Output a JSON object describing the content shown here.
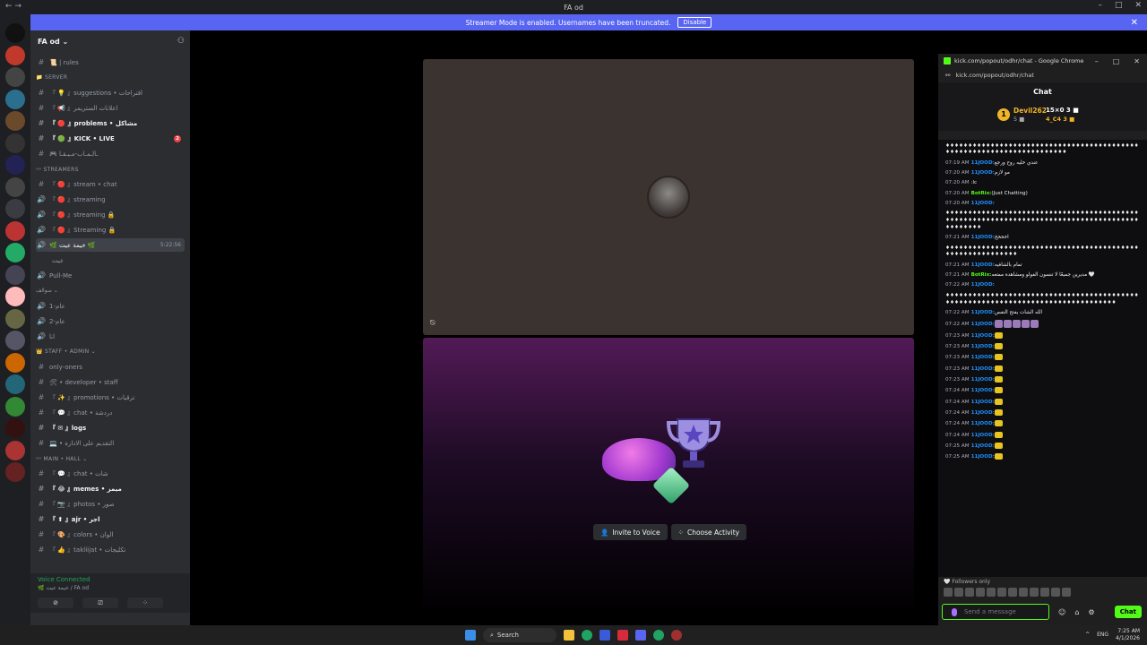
{
  "window": {
    "title": "FA od"
  },
  "banner": {
    "text": "Streamer Mode is enabled. Usernames have been truncated.",
    "button": "Disable"
  },
  "guild": {
    "name": "FA od ⌄"
  },
  "channels": [
    {
      "kind": "text",
      "label": "📜 | rules",
      "bold": false
    },
    {
      "kind": "cat",
      "label": "📁 SERVER"
    },
    {
      "kind": "text",
      "label": "『 💡 』suggestions • اقتراحات",
      "bold": false
    },
    {
      "kind": "text",
      "label": "『 📢 』اعلانات الستريمر",
      "bold": false
    },
    {
      "kind": "text",
      "label": "『 🔴 』problems • مشاكل",
      "bold": true
    },
    {
      "kind": "text",
      "label": "『 🟢 』KICK • LIVE",
      "bold": true,
      "count": "2"
    },
    {
      "kind": "text",
      "label": "🎮 ـالـمـاب-مـيـقـا",
      "bold": false
    },
    {
      "kind": "cat",
      "label": "〰 STREAMERS"
    },
    {
      "kind": "text",
      "label": "『 🔴 』stream • chat",
      "bold": false
    },
    {
      "kind": "voice",
      "label": "『 🔴 』streaming",
      "bold": false
    },
    {
      "kind": "voice",
      "label": "『 🔴 』streaming 🔒",
      "bold": false
    },
    {
      "kind": "voice",
      "label": "『 🔴 』Streaming 🔒",
      "bold": false
    },
    {
      "kind": "voice",
      "label": "🌿 خيمة عيت 🌿",
      "active": true,
      "time": "5:22:56"
    },
    {
      "kind": "member",
      "label": "عيت"
    },
    {
      "kind": "voice",
      "label": "Pull-Me",
      "bold": false
    },
    {
      "kind": "cat",
      "label": "سوالف ⌄"
    },
    {
      "kind": "voice",
      "label": "عام-1",
      "bold": false
    },
    {
      "kind": "voice",
      "label": "عام-2",
      "bold": false
    },
    {
      "kind": "voice",
      "label": "انا",
      "bold": false
    },
    {
      "kind": "cat",
      "label": "👑 STAFF • ADMIN ⌄"
    },
    {
      "kind": "text",
      "label": "only-oners",
      "bold": false
    },
    {
      "kind": "text",
      "label": "🛠 • developer • staff",
      "bold": false
    },
    {
      "kind": "text",
      "label": "『 ✨ 』promotions • ترقيات",
      "bold": false
    },
    {
      "kind": "text",
      "label": "『 💬 』chat • دردشة",
      "bold": false
    },
    {
      "kind": "text",
      "label": "『 ✉ 』logs",
      "bold": true
    },
    {
      "kind": "text",
      "label": "💻 • التقديم على الادارة",
      "bold": false
    },
    {
      "kind": "cat",
      "label": "〰 MAIN • HALL ⌄"
    },
    {
      "kind": "text",
      "label": "『 💬 』chat • شات",
      "bold": false
    },
    {
      "kind": "text",
      "label": "『 😂 』memes • ميمز",
      "bold": true
    },
    {
      "kind": "text",
      "label": "『 📷 』photos • صور",
      "bold": false
    },
    {
      "kind": "text",
      "label": "『 ⬆ 』ajr • اجر",
      "bold": true
    },
    {
      "kind": "text",
      "label": "『 🎨 』colors • الوان",
      "bold": false
    },
    {
      "kind": "text",
      "label": "『 👍 』takliijat • تكليجات",
      "bold": false
    }
  ],
  "voice": {
    "status": "Voice Connected",
    "sub": "🌿 خيمة عيت / FA od"
  },
  "activity": {
    "invite": "Invite to Voice",
    "choose": "Choose Activity"
  },
  "chrome": {
    "title": "kick.com/popout/odhr/chat - Google Chrome",
    "url": "kick.com/popout/odhr/chat"
  },
  "chat": {
    "header": "Chat",
    "pinned": {
      "user1": "Devil262",
      "user1_sub": "5 ■",
      "user2": "15×0 3 ■",
      "user2_sub": "4_C4 3 ■"
    },
    "messages": [
      {
        "t": "",
        "u": "",
        "txt": "♦♦♦♦♦♦♦♦♦♦♦♦♦♦♦♦♦♦♦♦♦♦♦♦♦♦♦♦♦♦♦♦♦♦♦♦♦♦♦♦♦♦♦♦♦♦♦♦♦♦♦♦♦♦♦♦♦♦♦♦♦♦♦♦♦♦♦♦♦♦"
      },
      {
        "t": "07:19 AM",
        "u": "11JOOD:",
        "txt": "عندي خليه روح ورجع"
      },
      {
        "t": "07:20 AM",
        "u": "11JOOD:",
        "txt": "مو لازم"
      },
      {
        "t": "07:20 AM",
        "u": "",
        "txt": ":lc"
      },
      {
        "t": "07:20 AM",
        "u": "BotRix:",
        "bot": true,
        "txt": "(Just Chatting)"
      },
      {
        "t": "07:20 AM",
        "u": "11JOOD:",
        "txt": ""
      },
      {
        "t": "",
        "u": "",
        "txt": "♦♦♦♦♦♦♦♦♦♦♦♦♦♦♦♦♦♦♦♦♦♦♦♦♦♦♦♦♦♦♦♦♦♦♦♦♦♦♦♦♦♦♦♦♦♦♦♦♦♦♦♦♦♦♦♦♦♦♦♦♦♦♦♦♦♦♦♦♦♦♦♦♦♦♦♦♦♦♦♦♦♦♦♦♦♦♦♦♦♦♦♦♦♦"
      },
      {
        "t": "07:21 AM",
        "u": "11JOOD:",
        "txt": "اخخخخ"
      },
      {
        "t": "",
        "u": "",
        "txt": "♦♦♦♦♦♦♦♦♦♦♦♦♦♦♦♦♦♦♦♦♦♦♦♦♦♦♦♦♦♦♦♦♦♦♦♦♦♦♦♦♦♦♦♦♦♦♦♦♦♦♦♦♦♦♦♦♦♦♦"
      },
      {
        "t": "07:21 AM",
        "u": "11JOOD:",
        "txt": "تمام بالشافيه"
      },
      {
        "t": "07:21 AM",
        "u": "BotRix:",
        "bot": true,
        "txt": "مديرين جميعًا لا تنسون الفولو ومشاهدة ممتعه 🤍"
      },
      {
        "t": "07:22 AM",
        "u": "11JOOD:",
        "txt": ""
      },
      {
        "t": "",
        "u": "",
        "txt": "♦♦♦♦♦♦♦♦♦♦♦♦♦♦♦♦♦♦♦♦♦♦♦♦♦♦♦♦♦♦♦♦♦♦♦♦♦♦♦♦♦♦♦♦♦♦♦♦♦♦♦♦♦♦♦♦♦♦♦♦♦♦♦♦♦♦♦♦♦♦♦♦♦♦♦♦♦♦♦♦♦"
      },
      {
        "t": "07:22 AM",
        "u": "11JOOD:",
        "txt": "الله الشات يفتح النفس"
      },
      {
        "t": "07:22 AM",
        "u": "11JOOD:",
        "txt": "",
        "pe": 5
      },
      {
        "t": "07:23 AM",
        "u": "11JOOD:",
        "txt": "",
        "e": 1
      },
      {
        "t": "07:23 AM",
        "u": "11JOOD:",
        "txt": "",
        "e": 1
      },
      {
        "t": "07:23 AM",
        "u": "11JOOD:",
        "txt": "",
        "e": 1
      },
      {
        "t": "07:23 AM",
        "u": "11JOOD:",
        "txt": "",
        "e": 1
      },
      {
        "t": "07:23 AM",
        "u": "11JOOD:",
        "txt": "",
        "e": 1
      },
      {
        "t": "07:24 AM",
        "u": "11JOOD:",
        "txt": "",
        "e": 1
      },
      {
        "t": "07:24 AM",
        "u": "11JOOD:",
        "txt": "",
        "e": 1
      },
      {
        "t": "07:24 AM",
        "u": "11JOOD:",
        "txt": "",
        "e": 1
      },
      {
        "t": "07:24 AM",
        "u": "11JOOD:",
        "txt": "",
        "e": 1
      },
      {
        "t": "07:24 AM",
        "u": "11JOOD:",
        "txt": "",
        "e": 1
      },
      {
        "t": "07:25 AM",
        "u": "11JOOD:",
        "txt": "",
        "e": 1
      },
      {
        "t": "07:25 AM",
        "u": "11JOOD:",
        "txt": "",
        "e": 1
      }
    ],
    "followers": "🤍 Followers only",
    "placeholder": "Send a message",
    "send": "Chat"
  },
  "taskbar": {
    "search": "Search",
    "lang": "ENG",
    "time": "7:25 AM",
    "date": "4/1/2026"
  },
  "colors": {
    "discord": "#5865f2",
    "kick": "#53fc18",
    "gold": "#f0b429"
  },
  "icons": [
    "discord-icon",
    "search-icon",
    "kick-icon",
    "chrome-icon",
    "microphone-icon",
    "trophy-icon"
  ]
}
